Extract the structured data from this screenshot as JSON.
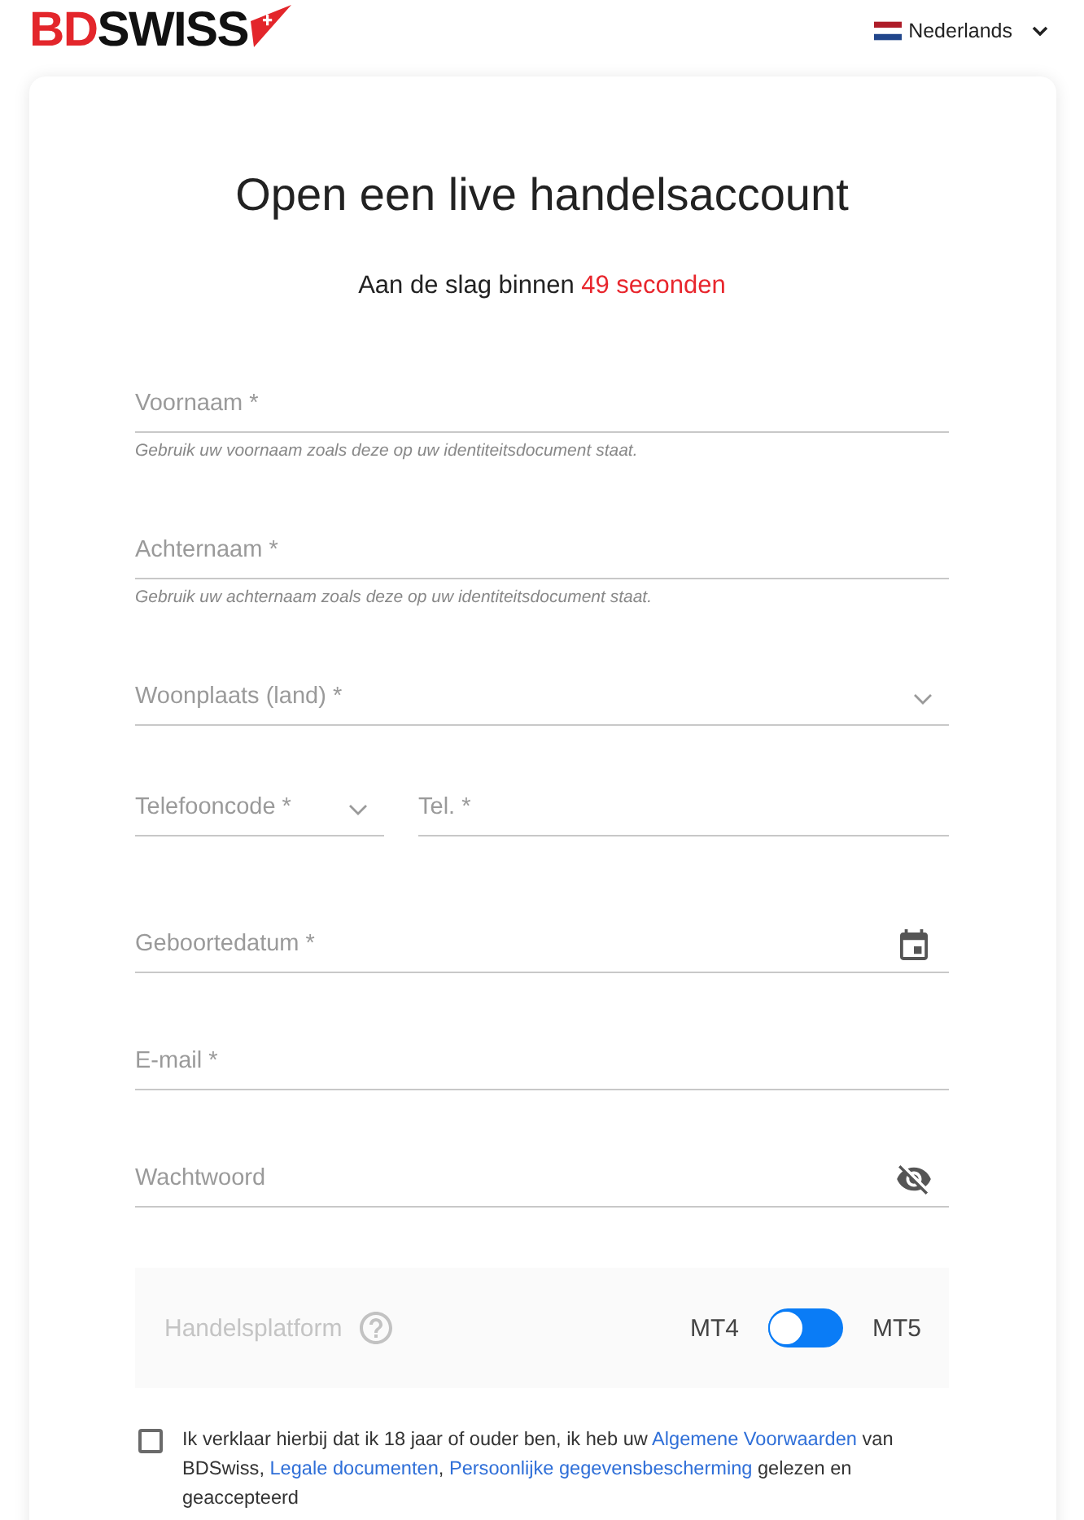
{
  "header": {
    "logo": {
      "first": "BD",
      "second": "SWISS"
    },
    "language": {
      "label": "Nederlands"
    }
  },
  "form": {
    "title": "Open een live handelsaccount",
    "subtitle": {
      "text": "Aan de slag binnen",
      "countdown": "49 seconden"
    },
    "fields": [
      {
        "kind": "text",
        "placeholder": "Voornaam *",
        "helper": "Gebruik uw voornaam zoals deze op uw identiteitsdocument staat."
      },
      {
        "kind": "text",
        "placeholder": "Achternaam *",
        "helper": "Gebruik uw achternaam zoals deze op uw identiteitsdocument staat."
      },
      {
        "kind": "select",
        "placeholder": "Woonplaats (land) *"
      },
      {
        "kind": "phone",
        "code": {
          "placeholder": "Telefooncode *"
        },
        "number": {
          "placeholder": "Tel. *"
        }
      },
      {
        "kind": "date",
        "placeholder": "Geboortedatum *"
      },
      {
        "kind": "text",
        "placeholder": "E-mail *"
      },
      {
        "kind": "password",
        "placeholder": "Wachtwoord"
      }
    ],
    "platform": {
      "label": "Handelsplatform",
      "left_option": "MT4",
      "right_option": "MT5",
      "switch": {
        "on": false
      }
    },
    "consent": {
      "checked": false,
      "parts": [
        {
          "kind": "text",
          "text": "Ik verklaar hierbij dat ik 18 jaar of ouder ben, ik heb uw "
        },
        {
          "kind": "link",
          "text": "Algemene Voorwaarden"
        },
        {
          "kind": "text",
          "text": " van BDSwiss, "
        },
        {
          "kind": "link",
          "text": "Legale documenten"
        },
        {
          "kind": "text",
          "text": ", "
        },
        {
          "kind": "link",
          "text": "Persoonlijke gegevensbescherming"
        },
        {
          "kind": "text",
          "text": " gelezen en geaccepteerd"
        }
      ]
    }
  }
}
